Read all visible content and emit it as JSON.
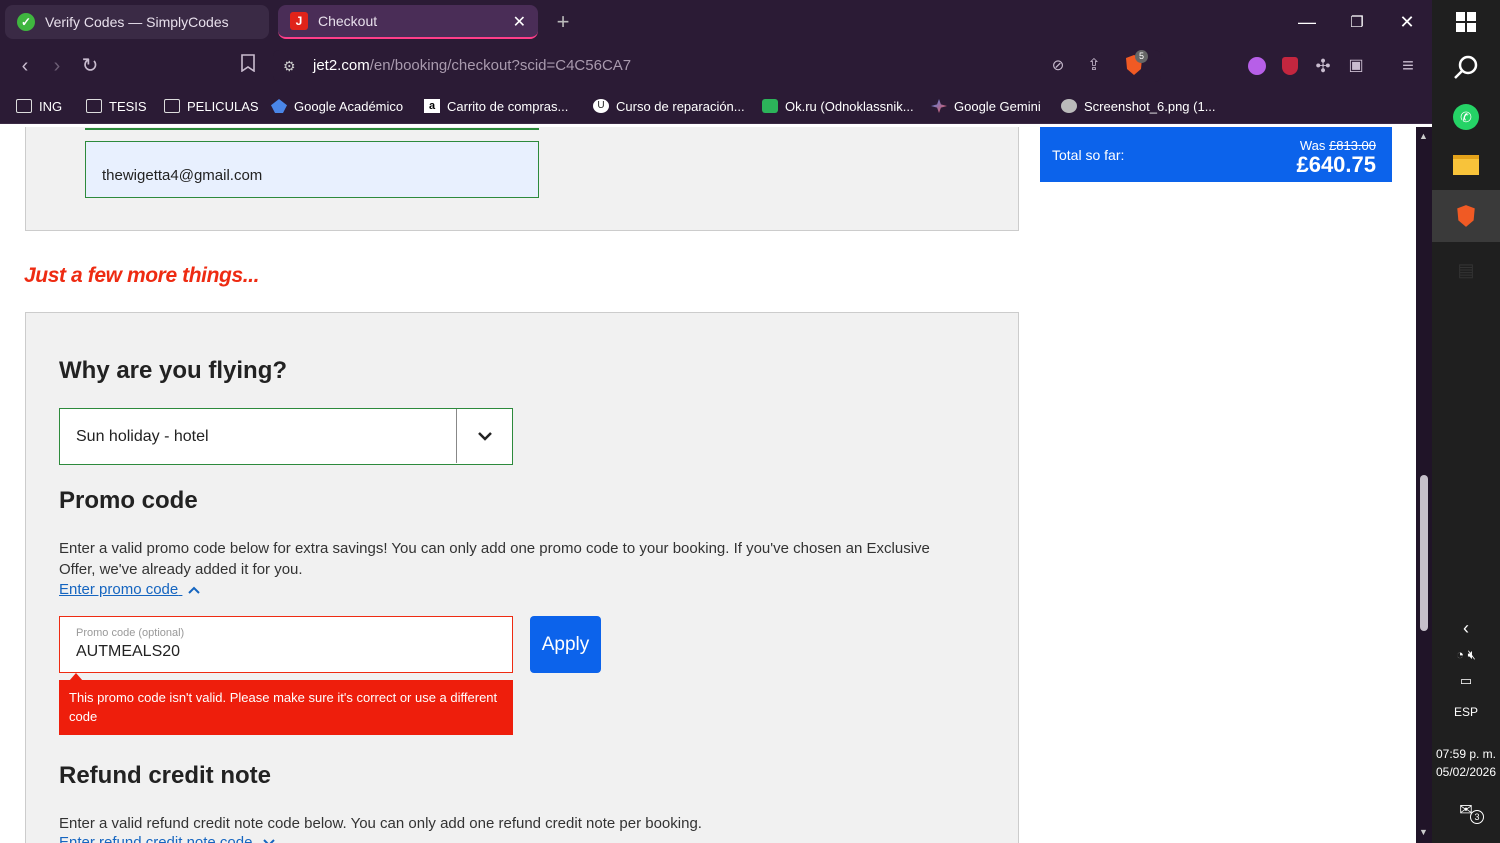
{
  "tabs": [
    {
      "title": "Verify Codes — SimplyCodes",
      "favicon_color": "#3fb63f",
      "active": false
    },
    {
      "title": "Checkout",
      "favicon_color": "#e0231a",
      "active": true
    }
  ],
  "toolbar": {
    "url_domain": "jet2.com",
    "url_path": "/en/booking/checkout?scid=C4C56CA7",
    "shield_count": "5"
  },
  "bookmarks": [
    {
      "label": "ING",
      "icon": "folder-icon"
    },
    {
      "label": "TESIS",
      "icon": "folder-icon"
    },
    {
      "label": "PELICULAS",
      "icon": "folder-icon"
    },
    {
      "label": "Google Académico",
      "icon": "scholar-icon"
    },
    {
      "label": "Carrito de compras...",
      "icon": "amazon-icon"
    },
    {
      "label": "Curso de reparación...",
      "icon": "udemy-icon"
    },
    {
      "label": "Ok.ru (Odnoklassnik...",
      "icon": "okru-icon"
    },
    {
      "label": "Google Gemini",
      "icon": "gemini-icon"
    },
    {
      "label": "Screenshot_6.png (1...",
      "icon": "globe-icon"
    }
  ],
  "checkout": {
    "email_value": "thewigetta4@gmail.com",
    "section_heading": "Just a few more things...",
    "why_flying_heading": "Why are you flying?",
    "why_flying_value": "Sun holiday - hotel",
    "promo_heading": "Promo code",
    "promo_text": "Enter a valid promo code below for extra savings! You can only add one promo code to your booking. If you've chosen an Exclusive Offer, we've already added it for you.",
    "promo_link": "Enter promo code",
    "promo_label": "Promo code (optional)",
    "promo_value": "AUTMEALS20",
    "apply_label": "Apply",
    "promo_error": "This promo code isn't valid. Please make sure it's correct or use a different code",
    "refund_heading": "Refund credit note",
    "refund_text": "Enter a valid refund credit note code below. You can only add one refund credit note per booking.",
    "refund_link": "Enter refund credit note code"
  },
  "summary": {
    "total_label": "Total so far:",
    "was_label": "Was",
    "was_price": "£813.00",
    "total_price": "£640.75"
  },
  "system": {
    "language": "ESP",
    "time": "07:59 p. m.",
    "date": "05/02/2026",
    "notification_count": "3"
  },
  "colors": {
    "brand_red": "#ee2b12",
    "brand_blue": "#0c63eb",
    "browser_bg": "#2b1b35"
  }
}
